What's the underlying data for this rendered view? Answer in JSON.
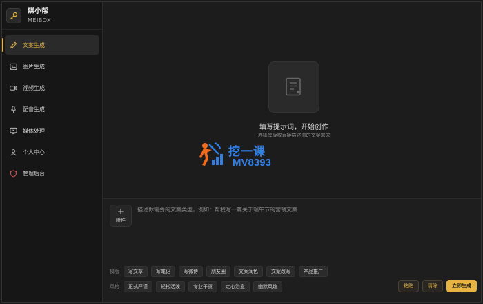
{
  "brand": {
    "name": "媒小帮",
    "sub": "MEIBOX",
    "logo_icon": "key-icon"
  },
  "nav": [
    {
      "label": "文案生成",
      "icon": "pen-icon",
      "active": true
    },
    {
      "label": "图片生成",
      "icon": "image-icon",
      "active": false
    },
    {
      "label": "视频生成",
      "icon": "video-icon",
      "active": false
    },
    {
      "label": "配音生成",
      "icon": "microphone-icon",
      "active": false
    },
    {
      "label": "媒体处理",
      "icon": "monitor-icon",
      "active": false
    },
    {
      "label": "个人中心",
      "icon": "user-icon",
      "active": false
    },
    {
      "label": "管理后台",
      "icon": "shield-icon",
      "active": false
    }
  ],
  "empty_state": {
    "title": "填写提示词，开始创作",
    "subtitle": "选择模版或直接描述你的文案需求",
    "icon": "document-icon"
  },
  "watermark": {
    "cn": "挖一课",
    "code": "MV8393"
  },
  "composer": {
    "attach_label": "附件",
    "value": "",
    "placeholder": "描述你需要的文案类型，例如：帮我写一篇关于端午节的营销文案",
    "template_label": "模版",
    "templates": [
      "写文章",
      "写笔记",
      "写微博",
      "朋友圈",
      "文案润色",
      "文案改写",
      "产品推广"
    ],
    "style_label": "风格",
    "styles": [
      "正式严谨",
      "轻松活泼",
      "专业干货",
      "走心治愈",
      "幽默风趣"
    ],
    "paste_label": "粘贴",
    "clear_label": "清除",
    "generate_label": "立即生成"
  },
  "colors": {
    "accent": "#e5b441",
    "watermark": "#2f7fe6",
    "bg": "#1b1b1b"
  }
}
